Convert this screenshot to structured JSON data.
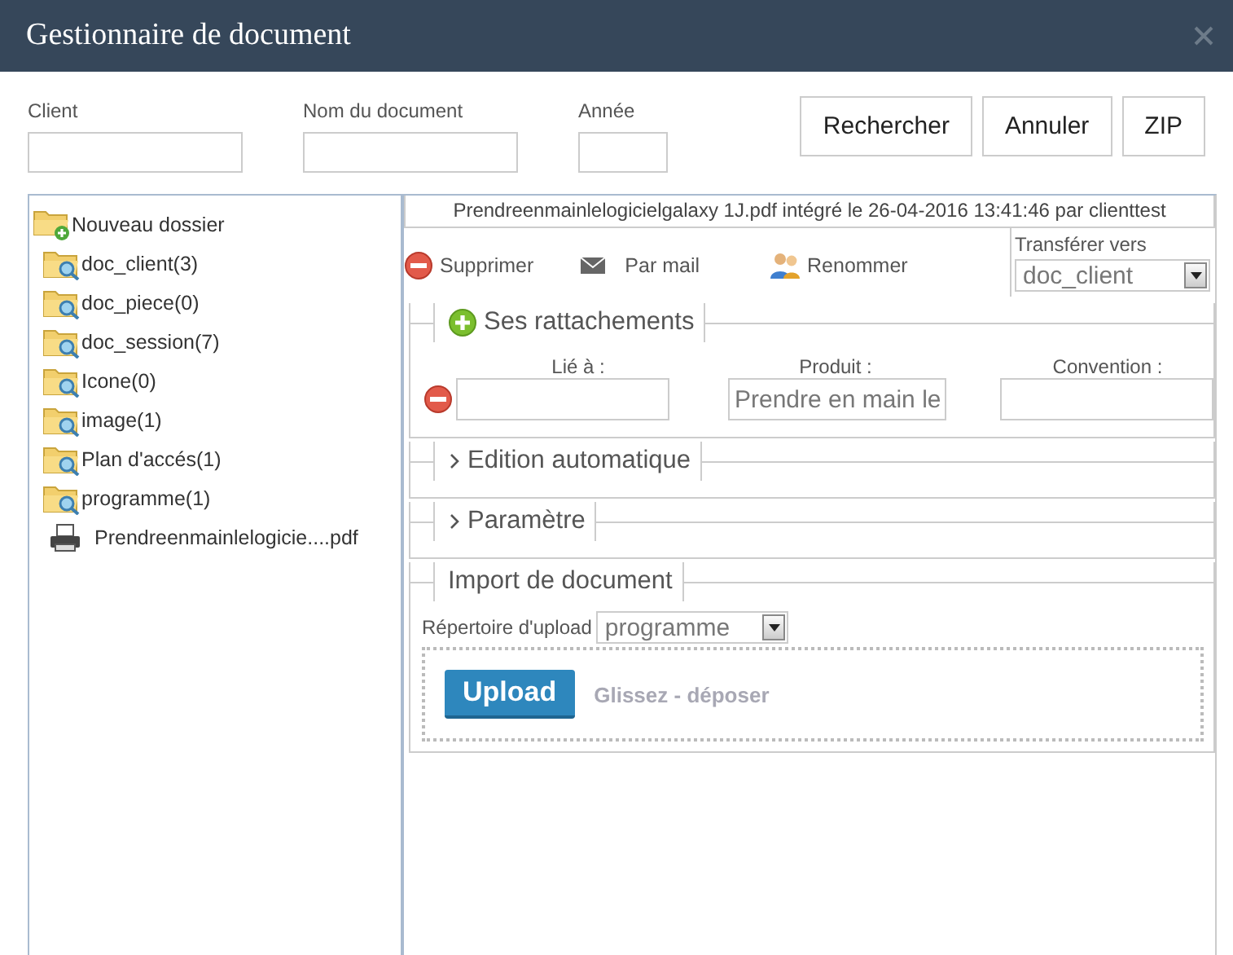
{
  "window": {
    "title": "Gestionnaire de document"
  },
  "search": {
    "fields": [
      {
        "label": "Client"
      },
      {
        "label": "Nom du document"
      },
      {
        "label": "Année"
      }
    ],
    "buttons": [
      "Rechercher",
      "Annuler",
      "ZIP"
    ]
  },
  "tree": {
    "items": [
      {
        "kind": "new",
        "label": "Nouveau dossier"
      },
      {
        "kind": "folder",
        "label": "doc_client(3)"
      },
      {
        "kind": "folder",
        "label": "doc_piece(0)"
      },
      {
        "kind": "folder",
        "label": "doc_session(7)"
      },
      {
        "kind": "folder",
        "label": "Icone(0)"
      },
      {
        "kind": "folder",
        "label": "image(1)"
      },
      {
        "kind": "folder",
        "label": "Plan d'accés(1)"
      },
      {
        "kind": "folder",
        "label": "programme(1)"
      },
      {
        "kind": "file",
        "label": "Prendreenmainlelogicie....pdf"
      }
    ]
  },
  "document": {
    "info": "Prendreenmainlelogicielgalaxy 1J.pdf intégré le 26-04-2016 13:41:46 par clienttest",
    "actions": [
      {
        "kind": "delete",
        "label": "Supprimer"
      },
      {
        "kind": "mail",
        "label": "Par mail"
      },
      {
        "kind": "rename",
        "label": "Renommer"
      }
    ],
    "transfer": {
      "label": "Transférer vers",
      "value": "doc_client"
    },
    "attachments": {
      "title": "Ses rattachements",
      "columns": [
        {
          "label": "Lié à :"
        },
        {
          "label": "Produit :",
          "value": "Prendre en main le"
        },
        {
          "label": "Convention :"
        }
      ]
    },
    "sections": [
      {
        "title": "Edition automatique",
        "expanded": false
      },
      {
        "title": "Paramètre",
        "expanded": false
      }
    ],
    "import": {
      "title": "Import de document",
      "folder_label": "Répertoire d'upload",
      "folder_value": "programme",
      "button": "Upload",
      "drop_hint": "Glissez - déposer"
    }
  }
}
